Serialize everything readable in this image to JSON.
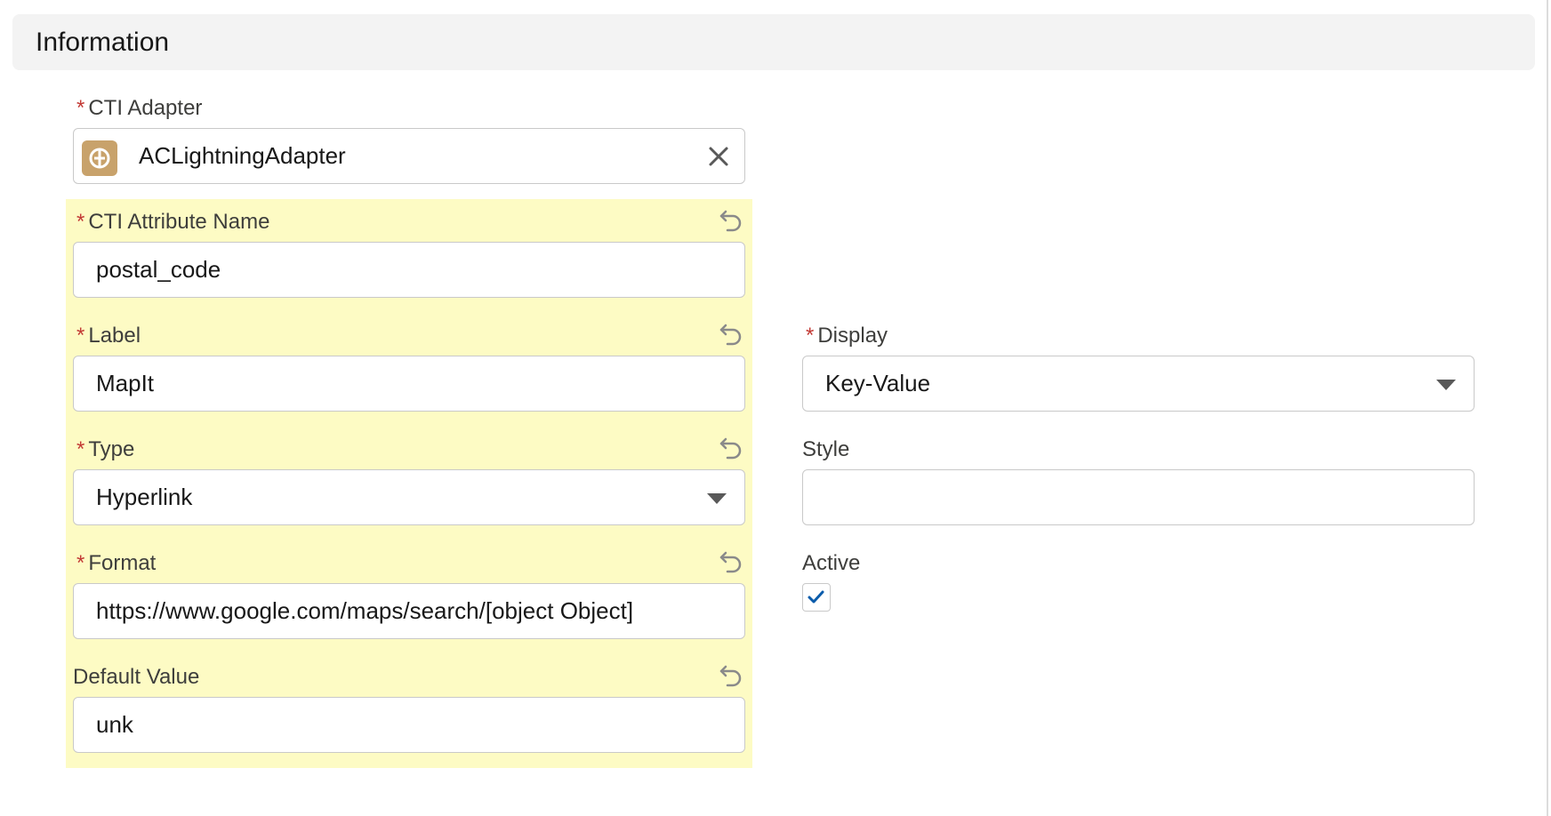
{
  "section": {
    "title": "Information"
  },
  "fields": {
    "cti_adapter": {
      "label": "CTI Adapter",
      "required_mark": "*",
      "value": "ACLightningAdapter",
      "icon": "adapter-icon",
      "clear_icon": "close-icon"
    },
    "cti_attribute_name": {
      "label": "CTI Attribute Name",
      "required_mark": "*",
      "value": "postal_code"
    },
    "label": {
      "label": "Label",
      "required_mark": "*",
      "value": "MapIt"
    },
    "type": {
      "label": "Type",
      "required_mark": "*",
      "value": "Hyperlink"
    },
    "format": {
      "label": "Format",
      "required_mark": "*",
      "value": "https://www.google.com/maps/search/[object Object]"
    },
    "default_value": {
      "label": "Default Value",
      "value": "unk"
    },
    "display": {
      "label": "Display",
      "required_mark": "*",
      "value": "Key-Value"
    },
    "style": {
      "label": "Style",
      "value": ""
    },
    "active": {
      "label": "Active",
      "checked": true
    }
  },
  "colors": {
    "changed_highlight": "#fdfbc4",
    "required": "#c23934",
    "checkbox_check": "#0b5cab",
    "adapter_badge": "#c8a26b"
  }
}
